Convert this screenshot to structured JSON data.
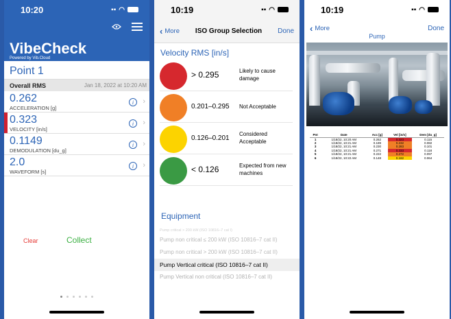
{
  "screen1": {
    "status_time": "10:20",
    "app_title": "VibeCheck",
    "powered_by": "Powered by Vib.Cloud",
    "point_name": "Point 1",
    "overall_label": "Overall RMS",
    "overall_timestamp": "Jan 18, 2022 at 10:20 AM",
    "measurements": [
      {
        "value": "0.262",
        "unit": "ACCELERATION [g]"
      },
      {
        "value": "0.323",
        "unit": "VELOCITY [in/s]"
      },
      {
        "value": "0.1149",
        "unit": "DEMODULATION [du_g]"
      },
      {
        "value": "2.0",
        "unit": "WAVEFORM [s]"
      }
    ],
    "active_measurement_index": 1,
    "active_indicator_color": "#d1202f",
    "clear_label": "Clear",
    "collect_label": "Collect",
    "page_count": 6,
    "current_page": 1,
    "header_color": "#2c64b6"
  },
  "screen2": {
    "status_time": "10:19",
    "back_label": "More",
    "title": "ISO Group Selection",
    "done_label": "Done",
    "section_title": "Velocity RMS [in/s]",
    "zones": [
      {
        "color": "#d6282e",
        "range": "> 0.295",
        "desc": "Likely to cause damage"
      },
      {
        "color": "#f07f26",
        "range": "0.201–0.295",
        "desc": "Not Acceptable"
      },
      {
        "color": "#fcd300",
        "range": "0.126–0.201",
        "desc": "Considered Acceptable"
      },
      {
        "color": "#3a9a44",
        "range": "< 0.126",
        "desc": "Expected from new machines"
      }
    ],
    "equipment_title": "Equipment",
    "equipment_items": [
      "Pump critical > 200 kW (ISO 10816–7 cat I)",
      "Pump non critical ≤ 200 kW (ISO 10816–7 cat II)",
      "Pump non critical > 200 kW (ISO 10816–7 cat II)",
      "Pump Vertical critical (ISO 10816–7 cat II)",
      "Pump Vertical non critical (ISO 10816–7 cat II)"
    ],
    "selected_equipment_index": 3
  },
  "screen3": {
    "status_time": "10:19",
    "back_label": "More",
    "done_label": "Done",
    "title": "Pump",
    "table": {
      "headers": [
        "Pnt",
        "Date",
        "Acc [g]",
        "Vel [in/s]",
        "Dem [du_g]"
      ],
      "rows": [
        {
          "pnt": "1",
          "date": "1/18/22, 10:20 AM",
          "acc": "0.262",
          "vel": "0.323",
          "dem": "0.115",
          "vel_color": "#d6282e"
        },
        {
          "pnt": "2",
          "date": "1/18/22, 10:21 AM",
          "acc": "0.189",
          "vel": "0.232",
          "dem": "0.082",
          "vel_color": "#f07f26"
        },
        {
          "pnt": "3",
          "date": "1/18/22, 10:21 AM",
          "acc": "0.230",
          "vel": "0.283",
          "dem": "0.101",
          "vel_color": "#f07f26"
        },
        {
          "pnt": "4",
          "date": "1/18/22, 10:21 AM",
          "acc": "0.271",
          "vel": "0.333",
          "dem": "0.118",
          "vel_color": "#d6282e"
        },
        {
          "pnt": "5",
          "date": "1/18/22, 10:21 AM",
          "acc": "0.222",
          "vel": "0.272",
          "dem": "0.097",
          "vel_color": "#f07f26"
        },
        {
          "pnt": "6",
          "date": "1/18/22, 10:22 AM",
          "acc": "0.148",
          "vel": "0.182",
          "dem": "0.064",
          "vel_color": "#fcd300"
        }
      ]
    }
  }
}
